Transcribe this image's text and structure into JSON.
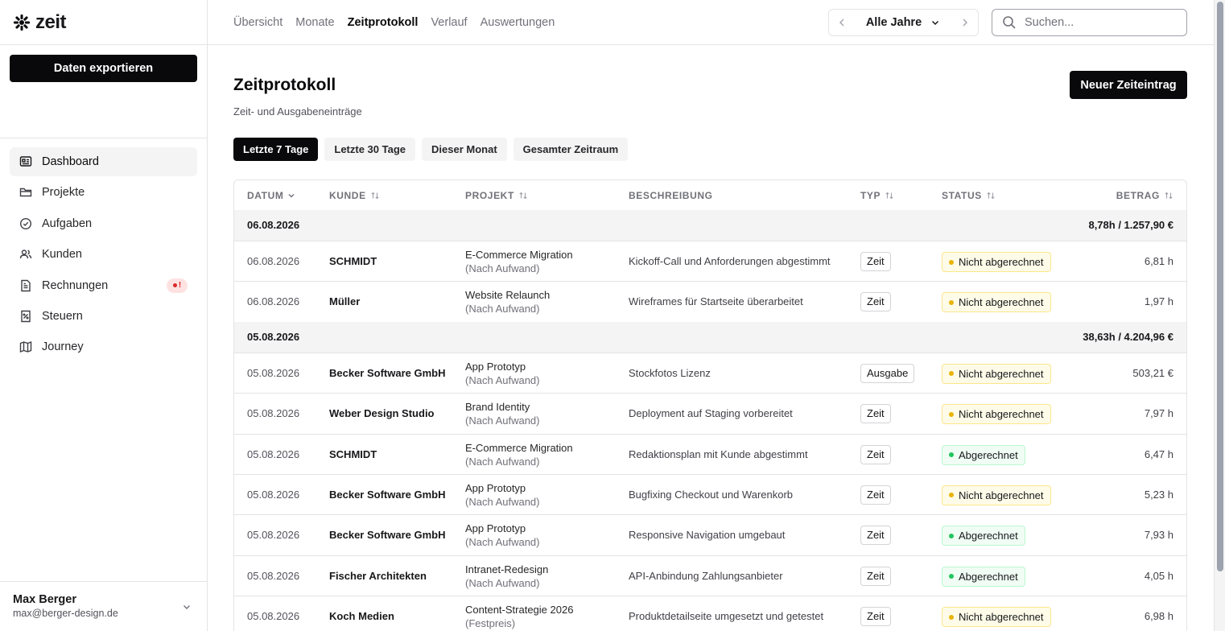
{
  "app": {
    "name": "zeit"
  },
  "sidebar": {
    "export_label": "Daten exportieren",
    "items": [
      {
        "label": "Dashboard",
        "icon": "dashboard-icon",
        "active": true
      },
      {
        "label": "Projekte",
        "icon": "folder-icon"
      },
      {
        "label": "Aufgaben",
        "icon": "check-circle-icon"
      },
      {
        "label": "Kunden",
        "icon": "users-icon"
      },
      {
        "label": "Rechnungen",
        "icon": "invoice-icon",
        "badge": "!"
      },
      {
        "label": "Steuern",
        "icon": "tax-icon"
      },
      {
        "label": "Journey",
        "icon": "map-icon"
      }
    ],
    "user": {
      "name": "Max Berger",
      "email": "max@berger-design.de"
    }
  },
  "topbar": {
    "tabs": [
      {
        "label": "Übersicht"
      },
      {
        "label": "Monate"
      },
      {
        "label": "Zeitprotokoll",
        "active": true
      },
      {
        "label": "Verlauf"
      },
      {
        "label": "Auswertungen"
      }
    ],
    "year_selector": "Alle Jahre",
    "search_placeholder": "Suchen..."
  },
  "page": {
    "title": "Zeitprotokoll",
    "subtitle": "Zeit- und Ausgabeneinträge",
    "new_button": "Neuer Zeiteintrag",
    "filters": [
      "Letzte 7 Tage",
      "Letzte 30 Tage",
      "Dieser Monat",
      "Gesamter Zeitraum"
    ],
    "active_filter": "Letzte 7 Tage"
  },
  "table": {
    "columns": [
      "Datum",
      "Kunde",
      "Projekt",
      "Beschreibung",
      "Typ",
      "Status",
      "Betrag"
    ],
    "groups": [
      {
        "date": "06.08.2026",
        "total": "8,78h / 1.257,90 €",
        "rows": [
          {
            "date": "06.08.2026",
            "client": "SCHMIDT",
            "project": "E-Commerce Migration",
            "billing": "(Nach Aufwand)",
            "description": "Kickoff-Call und Anforderungen abgestimmt",
            "type": "Zeit",
            "status": "Nicht abgerechnet",
            "amount": "6,81 h"
          },
          {
            "date": "06.08.2026",
            "client": "Müller",
            "project": "Website Relaunch",
            "billing": "(Nach Aufwand)",
            "description": "Wireframes für Startseite überarbeitet",
            "type": "Zeit",
            "status": "Nicht abgerechnet",
            "amount": "1,97 h"
          }
        ]
      },
      {
        "date": "05.08.2026",
        "total": "38,63h / 4.204,96 €",
        "rows": [
          {
            "date": "05.08.2026",
            "client": "Becker Software GmbH",
            "project": "App Prototyp",
            "billing": "(Nach Aufwand)",
            "description": "Stockfotos Lizenz",
            "type": "Ausgabe",
            "status": "Nicht abgerechnet",
            "amount": "503,21 €"
          },
          {
            "date": "05.08.2026",
            "client": "Weber Design Studio",
            "project": "Brand Identity",
            "billing": "(Nach Aufwand)",
            "description": "Deployment auf Staging vorbereitet",
            "type": "Zeit",
            "status": "Nicht abgerechnet",
            "amount": "7,97 h"
          },
          {
            "date": "05.08.2026",
            "client": "SCHMIDT",
            "project": "E-Commerce Migration",
            "billing": "(Nach Aufwand)",
            "description": "Redaktionsplan mit Kunde abgestimmt",
            "type": "Zeit",
            "status": "Abgerechnet",
            "amount": "6,47 h"
          },
          {
            "date": "05.08.2026",
            "client": "Becker Software GmbH",
            "project": "App Prototyp",
            "billing": "(Nach Aufwand)",
            "description": "Bugfixing Checkout und Warenkorb",
            "type": "Zeit",
            "status": "Nicht abgerechnet",
            "amount": "5,23 h"
          },
          {
            "date": "05.08.2026",
            "client": "Becker Software GmbH",
            "project": "App Prototyp",
            "billing": "(Nach Aufwand)",
            "description": "Responsive Navigation umgebaut",
            "type": "Zeit",
            "status": "Abgerechnet",
            "amount": "7,93 h"
          },
          {
            "date": "05.08.2026",
            "client": "Fischer Architekten",
            "project": "Intranet-Redesign",
            "billing": "(Nach Aufwand)",
            "description": "API-Anbindung Zahlungsanbieter",
            "type": "Zeit",
            "status": "Abgerechnet",
            "amount": "4,05 h"
          },
          {
            "date": "05.08.2026",
            "client": "Koch Medien",
            "project": "Content-Strategie 2026",
            "billing": "(Festpreis)",
            "description": "Produktdetailseite umgesetzt und getestet",
            "type": "Zeit",
            "status": "Nicht abgerechnet",
            "amount": "6,98 h"
          }
        ]
      }
    ]
  },
  "colors": {
    "primary": "#09090b",
    "status_open": "#eab308",
    "status_done": "#22c55e",
    "alert": "#dc2626"
  }
}
